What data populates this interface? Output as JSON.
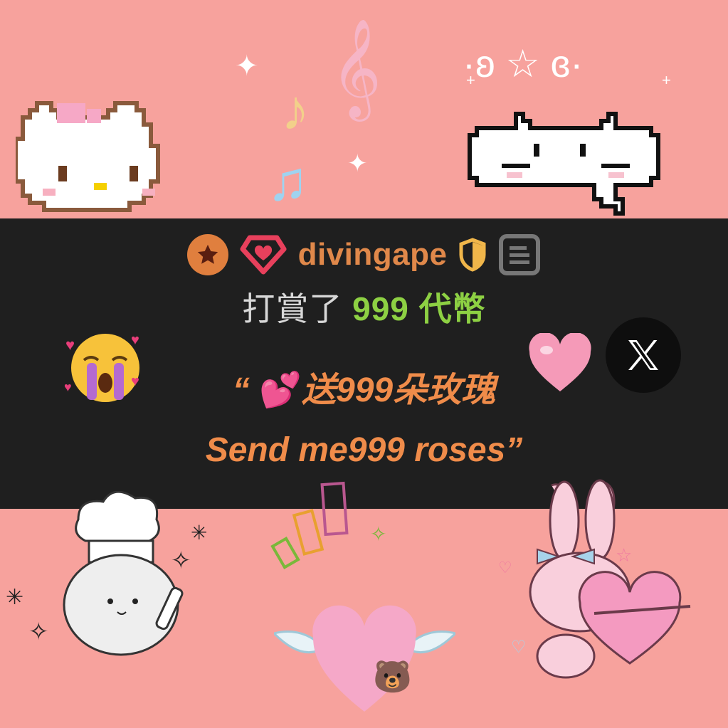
{
  "user": {
    "name": "divingape",
    "rank_icon": "star-badge-icon",
    "tier_icon": "diamond-heart-icon",
    "shield_icon": "shield-icon",
    "profile_icon": "card-icon"
  },
  "tip": {
    "prefix": "打賞了",
    "amount": "999",
    "currency": "代幣"
  },
  "message": {
    "line1_open_quote": "“",
    "line1_text": "送999朵玫瑰",
    "line2_text": "Send me999 roses”"
  },
  "kaomoji": "·ʚ ☆ ɞ·",
  "colors": {
    "background": "#f7a29d",
    "banner": "#1f1f1f",
    "username": "#e0884a",
    "amount": "#8dd043",
    "message": "#f08c4a"
  },
  "share": {
    "icon": "x-logo-icon"
  }
}
